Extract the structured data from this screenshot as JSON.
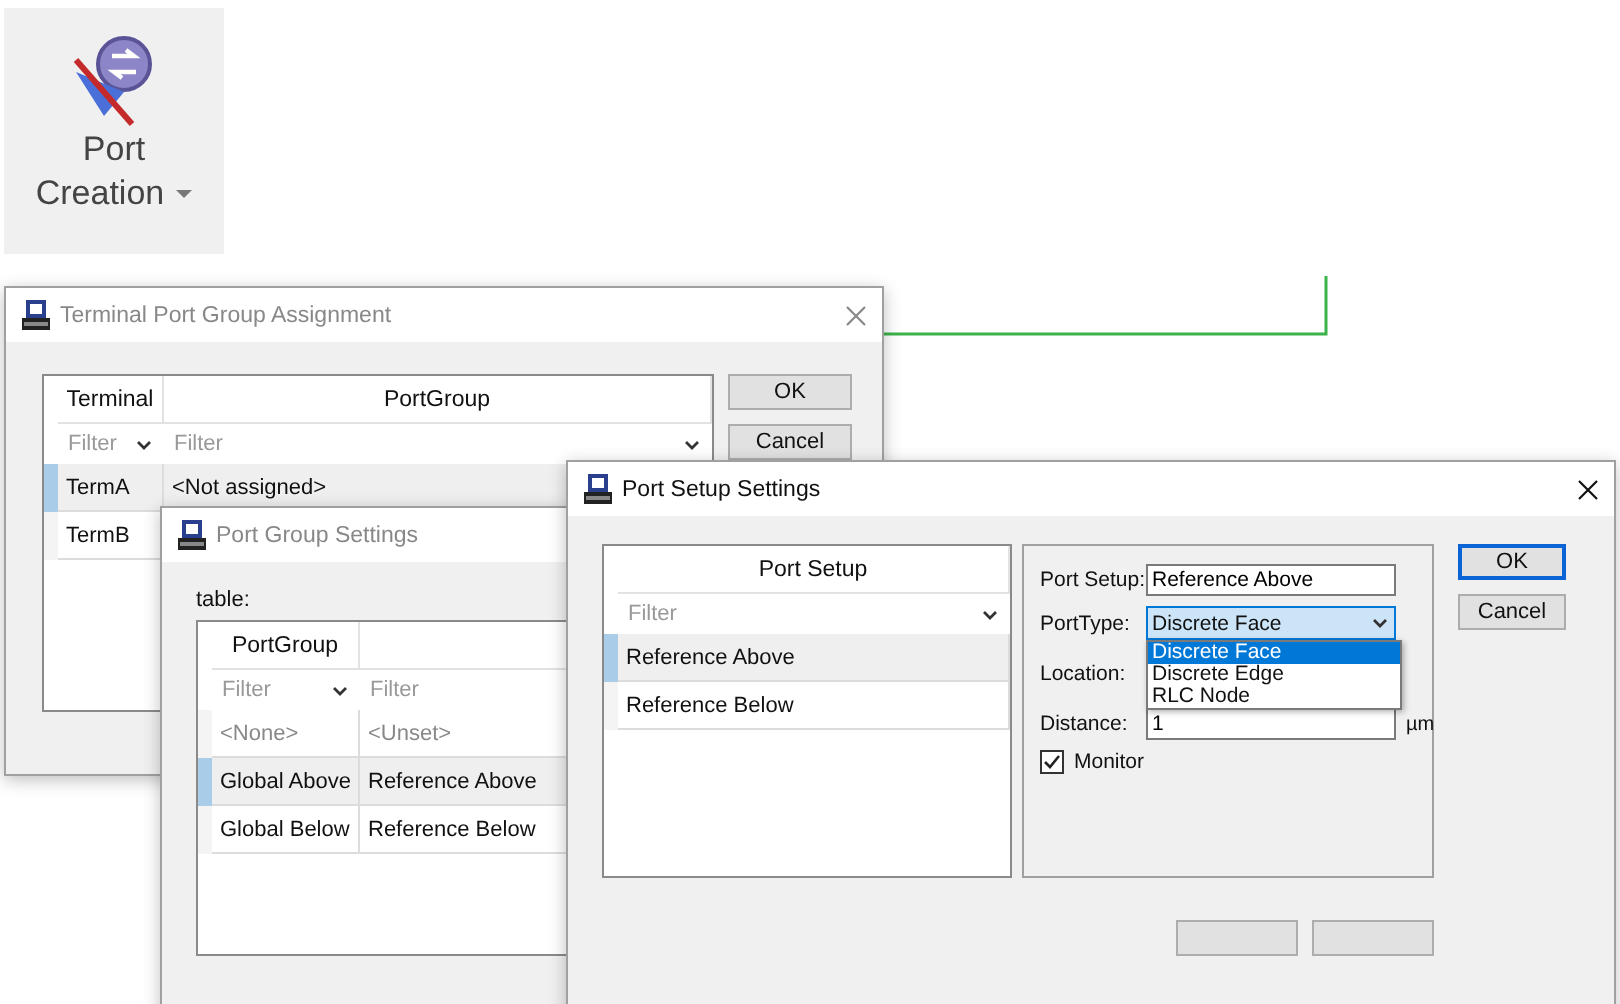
{
  "ribbon_button": {
    "lines": [
      "Port",
      "Creation"
    ]
  },
  "terminal_dialog": {
    "title": "Terminal Port Group Assignment",
    "columns": [
      "Terminal",
      "PortGroup"
    ],
    "filters": [
      {
        "placeholder": "Filter"
      },
      {
        "placeholder": "Filter"
      }
    ],
    "rows": [
      {
        "cells": [
          "TermA",
          "<Not assigned>"
        ],
        "selected": true
      },
      {
        "cells": [
          "TermB"
        ],
        "selected": false
      }
    ],
    "buttons": [
      "OK",
      "Cancel"
    ]
  },
  "group_dialog": {
    "title": "Port Group Settings",
    "table_label": "table:",
    "columns": [
      "PortGroup"
    ],
    "filters": [
      {
        "placeholder": "Filter"
      },
      {
        "placeholder": "Filter"
      }
    ],
    "rows": [
      {
        "kind": "placeholder",
        "cells": [
          "<None>",
          "<Unset>"
        ],
        "selected": false
      },
      {
        "kind": "item",
        "cells": [
          "Global Above",
          "Reference Above"
        ],
        "selected": true
      },
      {
        "kind": "item",
        "cells": [
          "Global Below",
          "Reference Below"
        ],
        "selected": false
      }
    ]
  },
  "setup_dialog": {
    "title": "Port Setup Settings",
    "list": {
      "column": "Port Setup",
      "filter": {
        "placeholder": "Filter"
      },
      "items": [
        {
          "label": "Reference Above",
          "selected": true
        },
        {
          "label": "Reference Below",
          "selected": false
        }
      ]
    },
    "form": {
      "port_setup": {
        "label": "Port Setup:",
        "value": "Reference Above"
      },
      "port_type": {
        "label": "PortType:",
        "value": "Discrete Face",
        "expanded": true,
        "options": [
          {
            "label": "Discrete Face",
            "selected": true
          },
          {
            "label": "Discrete Edge",
            "selected": false
          },
          {
            "label": "RLC Node",
            "selected": false
          }
        ]
      },
      "location": {
        "label": "Location:"
      },
      "distance": {
        "label": "Distance:",
        "value": "1",
        "unit": "µm"
      },
      "monitor": {
        "label": "Monitor",
        "checked": true
      }
    },
    "buttons": [
      {
        "label": "OK",
        "default": true
      },
      {
        "label": "Cancel",
        "default": false
      }
    ]
  }
}
